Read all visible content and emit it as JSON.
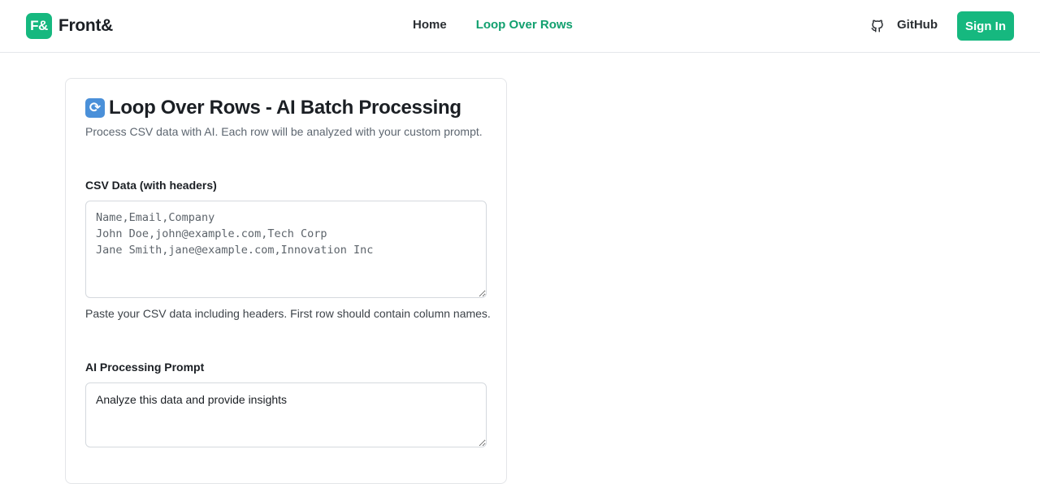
{
  "header": {
    "logo_text": "F&",
    "brand_name": "Front&",
    "nav": [
      {
        "label": "Home",
        "active": false
      },
      {
        "label": "Loop Over Rows",
        "active": true
      }
    ],
    "github_label": "GitHub",
    "signin_label": "Sign In",
    "accent_color": "#16b87f"
  },
  "main": {
    "title": "Loop Over Rows - AI Batch Processing",
    "title_icon": "cycle-arrows-icon",
    "subtitle": "Process CSV data with AI. Each row will be analyzed with your custom prompt.",
    "csv": {
      "label": "CSV Data (with headers)",
      "placeholder": "Name,Email,Company\nJohn Doe,john@example.com,Tech Corp\nJane Smith,jane@example.com,Innovation Inc",
      "value": "",
      "help": "Paste your CSV data including headers. First row should contain column names."
    },
    "prompt": {
      "label": "AI Processing Prompt",
      "value": "Analyze this data and provide insights"
    }
  }
}
